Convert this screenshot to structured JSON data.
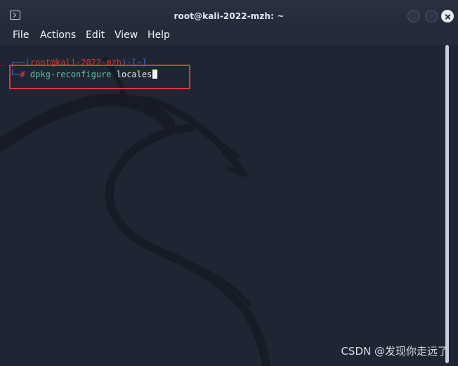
{
  "window": {
    "title": "root@kali-2022-mzh: ~"
  },
  "menu": {
    "items": [
      "File",
      "Actions",
      "Edit",
      "View",
      "Help"
    ]
  },
  "terminal": {
    "prompt_user": "root@kali-2022-mzh",
    "prompt_cwd": "~",
    "prompt_hash": "#",
    "command": "dpkg-reconfigure",
    "argument": "locales"
  },
  "watermark": "CSDN @发现你走远了",
  "colors": {
    "highlight_box": "#e5333a",
    "prompt_user": "#d33b3b",
    "prompt_frame": "#3a6fd1",
    "command": "#5ec0a4"
  },
  "icons": [
    "terminal-icon",
    "minimize-icon",
    "maximize-icon",
    "close-icon"
  ]
}
